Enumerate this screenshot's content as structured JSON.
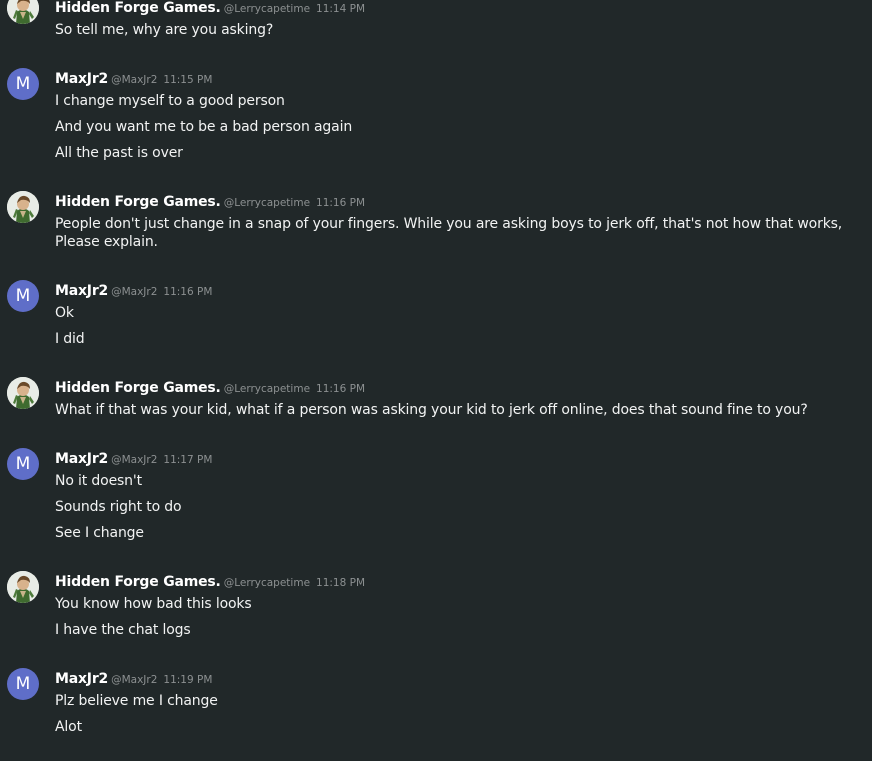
{
  "groups": [
    {
      "author": "Hidden Forge Games.",
      "handle": "@Lerrycapetime",
      "time": "11:14 PM",
      "avatar": "hidden-forge",
      "lines": [
        "So tell me, why are you asking?"
      ]
    },
    {
      "author": "MaxJr2",
      "handle": "@MaxJr2",
      "time": "11:15 PM",
      "avatar": "M",
      "lines": [
        "I change myself to a good person",
        "And you want me to be a bad person again",
        "All the past is over"
      ]
    },
    {
      "author": "Hidden Forge Games.",
      "handle": "@Lerrycapetime",
      "time": "11:16 PM",
      "avatar": "hidden-forge",
      "lines": [
        "People don't just change in a snap of your fingers. While you are asking boys to jerk off, that's not how that works, Please explain."
      ]
    },
    {
      "author": "MaxJr2",
      "handle": "@MaxJr2",
      "time": "11:16 PM",
      "avatar": "M",
      "lines": [
        "Ok",
        "I did"
      ]
    },
    {
      "author": "Hidden Forge Games.",
      "handle": "@Lerrycapetime",
      "time": "11:16 PM",
      "avatar": "hidden-forge",
      "lines": [
        "What if that was your kid, what if a person was asking your kid to jerk off online, does that sound fine to you?"
      ]
    },
    {
      "author": "MaxJr2",
      "handle": "@MaxJr2",
      "time": "11:17 PM",
      "avatar": "M",
      "lines": [
        "No it doesn't",
        "Sounds right to do",
        "See I change"
      ]
    },
    {
      "author": "Hidden Forge Games.",
      "handle": "@Lerrycapetime",
      "time": "11:18 PM",
      "avatar": "hidden-forge",
      "lines": [
        "You know how bad this looks",
        "I have the chat logs"
      ]
    },
    {
      "author": "MaxJr2",
      "handle": "@MaxJr2",
      "time": "11:19 PM",
      "avatar": "M",
      "lines": [
        "Plz believe me I change",
        "Alot"
      ]
    }
  ],
  "colors": {
    "background": "#212829",
    "avatar_m": "#5f6ec8",
    "username": "#ffffff",
    "meta": "#8c9091",
    "text": "#f2f3f3"
  }
}
